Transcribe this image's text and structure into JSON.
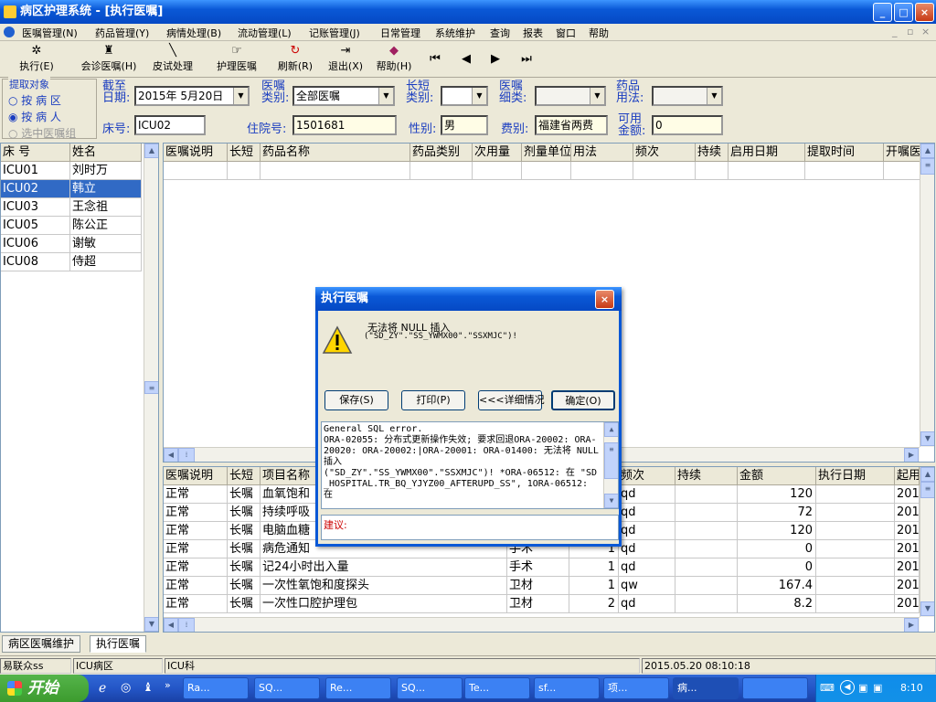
{
  "window": {
    "title": "病区护理系统 - [执行医嘱]",
    "min": "_",
    "max": "□",
    "close": "×"
  },
  "menu": [
    "医嘱管理(N)",
    "药品管理(Y)",
    "病情处理(B)",
    "流动管理(L)",
    "记账管理(J)",
    "日常管理",
    "系统维护",
    "查询",
    "报表",
    "窗口",
    "帮助"
  ],
  "toolbar": [
    {
      "label": "执行(E)",
      "icon": "✲"
    },
    {
      "label": "会诊医嘱(H)",
      "icon": "♜"
    },
    {
      "label": "皮试处理",
      "icon": "╲"
    },
    {
      "label": "护理医嘱",
      "icon": "☞"
    },
    {
      "label": "刷新(R)",
      "icon": "↻"
    },
    {
      "label": "退出(X)",
      "icon": "⇥"
    },
    {
      "label": "帮助(H)",
      "icon": "◆"
    },
    {
      "label": "",
      "icon": "⏮"
    },
    {
      "label": "",
      "icon": "◀"
    },
    {
      "label": "",
      "icon": "▶"
    },
    {
      "label": "",
      "icon": "⏭"
    }
  ],
  "filters": {
    "group_title": "提取对象",
    "radio_ward": "按 病 区",
    "radio_patient": "按 病 人",
    "check_selected": "选中医嘱组",
    "cutoff_label1": "截至",
    "cutoff_label2": "日期:",
    "cutoff_value": "2015年 5月20日",
    "type_label1": "医嘱",
    "type_label2": "类别:",
    "type_value": "全部医嘱",
    "longshort_label1": "长短",
    "longshort_label2": "类别:",
    "longshort_value": "",
    "detail_label1": "医嘱",
    "detail_label2": "细类:",
    "detail_value": "",
    "usage_label1": "药品",
    "usage_label2": "用法:",
    "usage_value": "",
    "bed_label": "床号:",
    "bed_value": "ICU02",
    "admission_label": "住院号:",
    "admission_value": "1501681",
    "gender_label": "性别:",
    "gender_value": "男",
    "fee_label": "费别:",
    "fee_value": "福建省两费",
    "balance_label1": "可用",
    "balance_label2": "金额:",
    "balance_value": "0"
  },
  "patients": {
    "headers": [
      "床 号",
      "姓名"
    ],
    "rows": [
      [
        "ICU01",
        "刘时万"
      ],
      [
        "ICU02",
        "韩立"
      ],
      [
        "ICU03",
        "王念祖"
      ],
      [
        "ICU05",
        "陈公正"
      ],
      [
        "ICU06",
        "谢敏"
      ],
      [
        "ICU08",
        "侍超"
      ]
    ],
    "selected_index": 1
  },
  "drug_grid": {
    "headers": [
      "医嘱说明",
      "长短",
      "药品名称",
      "药品类别",
      "次用量",
      "剂量单位",
      "用法",
      "频次",
      "持续",
      "启用日期",
      "提取时间",
      "开嘱医"
    ]
  },
  "item_grid": {
    "headers": [
      "医嘱说明",
      "长短",
      "项目名称",
      "",
      "",
      "频次",
      "持续",
      "金额",
      "执行日期",
      "起用"
    ],
    "rows": [
      [
        "正常",
        "长嘱",
        "血氧饱和",
        "",
        "",
        "qd",
        "",
        "120",
        "",
        "201"
      ],
      [
        "正常",
        "长嘱",
        "持续呼吸",
        "",
        "",
        "qd",
        "",
        "72",
        "",
        "201"
      ],
      [
        "正常",
        "长嘱",
        "电脑血糖",
        "",
        "",
        "qd",
        "",
        "120",
        "",
        "201"
      ],
      [
        "正常",
        "长嘱",
        "病危通知",
        "手术",
        "1",
        "qd",
        "",
        "0",
        "",
        "201"
      ],
      [
        "正常",
        "长嘱",
        "记24小时出入量",
        "手术",
        "1",
        "qd",
        "",
        "0",
        "",
        "201"
      ],
      [
        "正常",
        "长嘱",
        "一次性氧饱和度探头",
        "卫材",
        "1",
        "qw",
        "",
        "167.4",
        "",
        "201"
      ],
      [
        "正常",
        "长嘱",
        "一次性口腔护理包",
        "卫材",
        "2",
        "qd",
        "",
        "8.2",
        "",
        "201"
      ]
    ]
  },
  "dialog": {
    "title": "执行医嘱",
    "message_line1": "无法将 NULL 插入",
    "message_line2": "(\"SD_ZY\".\"SS_YWMX00\".\"SSXMJC\")!",
    "btn_save": "保存(S)",
    "btn_print": "打印(P)",
    "btn_detail": "<<<详细情况",
    "btn_ok": "确定(O)",
    "detail_text": "General SQL error.\nORA-02055: 分布式更新操作失效; 要求回退ORA-20002: ORA-20020: ORA-20002:|ORA-20001: ORA-01400: 无法将 NULL 插入\n(\"SD_ZY\".\"SS_YWMX00\".\"SSXMJC\")! *ORA-06512: 在 \"SD_HOSPITAL.TR_BQ_YJYZ00_AFTERUPD_SS\", 1ORA-06512: 在",
    "suggest_label": "建议:"
  },
  "tabs": [
    "病区医嘱维护",
    "执行医嘱"
  ],
  "status": {
    "user": "易联众ss",
    "ward": "ICU病区",
    "dept": "ICU科",
    "datetime": "2015.05.20 08:10:18"
  },
  "taskbar": {
    "start": "开始",
    "tasks": [
      "Ra...",
      "SQ...",
      "Re...",
      "SQ...",
      "Te...",
      "sf...",
      "项...",
      "病...",
      ""
    ],
    "clock": "8:10"
  }
}
